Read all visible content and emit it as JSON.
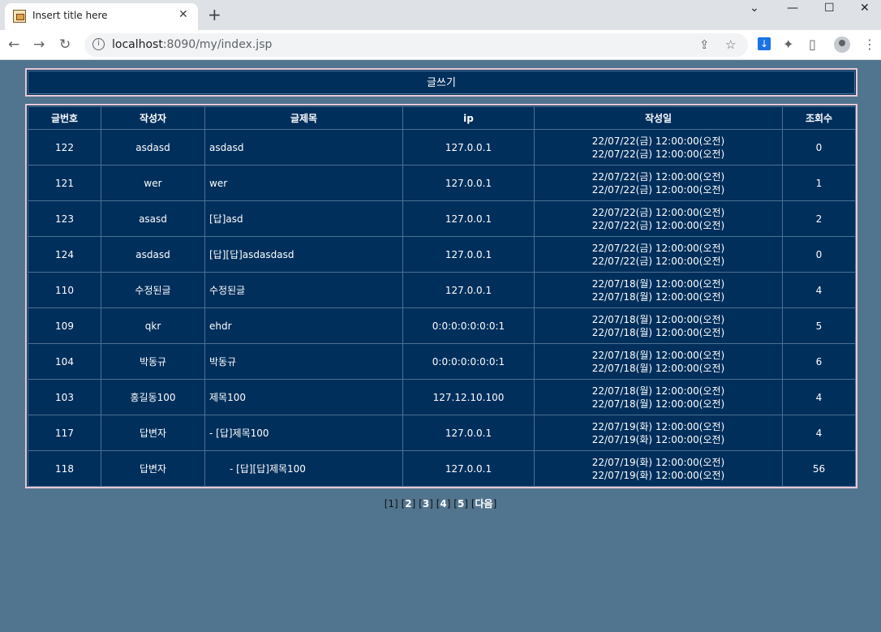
{
  "browser": {
    "tab_title": "Insert title here",
    "url_host": "localhost",
    "url_rest": ":8090/my/index.jsp"
  },
  "board": {
    "write_label": "글쓰기",
    "headers": {
      "no": "글번호",
      "writer": "작성자",
      "title": "글제목",
      "ip": "ip",
      "date": "작성일",
      "views": "조회수"
    },
    "rows": [
      {
        "no": "122",
        "writer": "asdasd",
        "title": "asdasd",
        "ip": "127.0.0.1",
        "date1": "22/07/22(금) 12:00:00(오전)",
        "date2": "22/07/22(금) 12:00:00(오전)",
        "views": "0"
      },
      {
        "no": "121",
        "writer": "wer",
        "title": "wer",
        "ip": "127.0.0.1",
        "date1": "22/07/22(금) 12:00:00(오전)",
        "date2": "22/07/22(금) 12:00:00(오전)",
        "views": "1"
      },
      {
        "no": "123",
        "writer": "asasd",
        "title": "[답]asd",
        "ip": "127.0.0.1",
        "date1": "22/07/22(금) 12:00:00(오전)",
        "date2": "22/07/22(금) 12:00:00(오전)",
        "views": "2"
      },
      {
        "no": "124",
        "writer": "asdasd",
        "title": "[답][답]asdasdasd",
        "ip": "127.0.0.1",
        "date1": "22/07/22(금) 12:00:00(오전)",
        "date2": "22/07/22(금) 12:00:00(오전)",
        "views": "0"
      },
      {
        "no": "110",
        "writer": "수정된글",
        "title": "수정된글",
        "ip": "127.0.0.1",
        "date1": "22/07/18(월) 12:00:00(오전)",
        "date2": "22/07/18(월) 12:00:00(오전)",
        "views": "4"
      },
      {
        "no": "109",
        "writer": "qkr",
        "title": "ehdr",
        "ip": "0:0:0:0:0:0:0:1",
        "date1": "22/07/18(월) 12:00:00(오전)",
        "date2": "22/07/18(월) 12:00:00(오전)",
        "views": "5"
      },
      {
        "no": "104",
        "writer": "박동규",
        "title": "박동규",
        "ip": "0:0:0:0:0:0:0:1",
        "date1": "22/07/18(월) 12:00:00(오전)",
        "date2": "22/07/18(월) 12:00:00(오전)",
        "views": "6"
      },
      {
        "no": "103",
        "writer": "홍길동100",
        "title": "제목100",
        "ip": "127.12.10.100",
        "date1": "22/07/18(월) 12:00:00(오전)",
        "date2": "22/07/18(월) 12:00:00(오전)",
        "views": "4"
      },
      {
        "no": "117",
        "writer": "답변자",
        "title": "- [답]제목100",
        "ip": "127.0.0.1",
        "date1": "22/07/19(화) 12:00:00(오전)",
        "date2": "22/07/19(화) 12:00:00(오전)",
        "views": "4"
      },
      {
        "no": "118",
        "writer": "답변자",
        "title": "- [답][답]제목100",
        "ip": "127.0.0.1",
        "date1": "22/07/19(화) 12:00:00(오전)",
        "date2": "22/07/19(화) 12:00:00(오전)",
        "views": "56"
      }
    ]
  },
  "pager": {
    "p1": "1",
    "p2": "2",
    "p3": "3",
    "p4": "4",
    "p5": "5",
    "next": "다음"
  }
}
